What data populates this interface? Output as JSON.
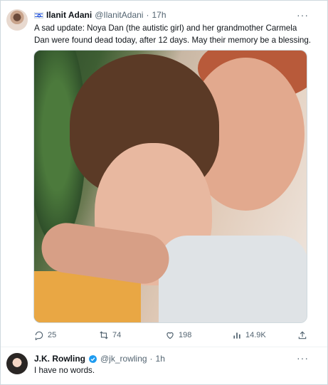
{
  "tweet": {
    "author_name": "Ilanit Adani",
    "author_handle": "@IlanitAdani",
    "separator": "·",
    "time": "17h",
    "text": "A sad update: Noya Dan (the autistic girl) and her grandmother Carmela Dan were found dead today, after 12 days. May their memory be a blessing.",
    "more_label": "···",
    "stats": {
      "replies": "25",
      "retweets": "74",
      "likes": "198",
      "views": "14.9K"
    }
  },
  "reply": {
    "author_name": "J.K. Rowling",
    "author_handle": "@jk_rowling",
    "separator": "·",
    "time": "1h",
    "text": "I have no words.",
    "more_label": "···"
  },
  "colors": {
    "text": "#0f1419",
    "muted": "#536471",
    "border": "#cfd9de",
    "verified": "#1d9bf0"
  },
  "icons": [
    "flag-icon",
    "reply-icon",
    "retweet-icon",
    "like-icon",
    "views-icon",
    "share-icon",
    "verified-icon",
    "more-icon"
  ]
}
